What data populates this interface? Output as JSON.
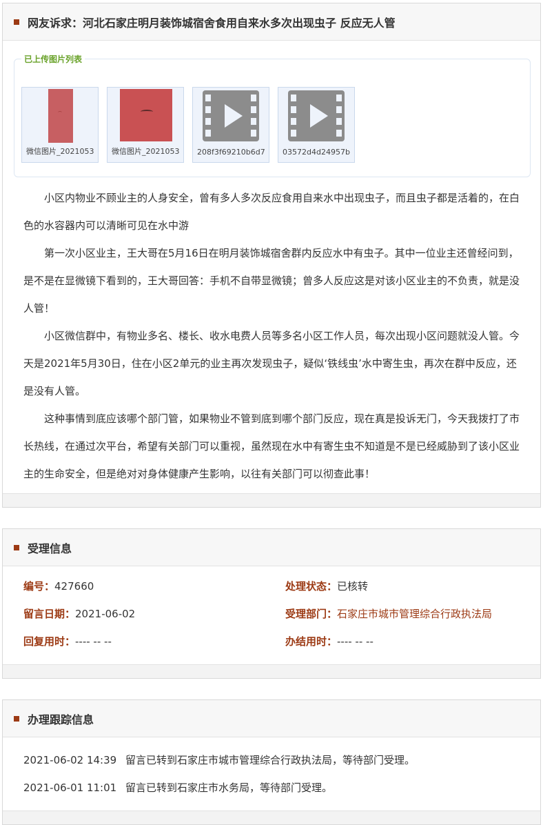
{
  "petition": {
    "title": "网友诉求：河北石家庄明月装饰城宿舍食用自来水多次出现虫子 反应无人管",
    "uploads_legend": "已上传图片列表",
    "uploads": [
      {
        "caption": "微信图片_2021053",
        "type": "image"
      },
      {
        "caption": "微信图片_2021053",
        "type": "image"
      },
      {
        "caption": "208f3f69210b6d7",
        "type": "video",
        "icon": "film-play-icon"
      },
      {
        "caption": "03572d4d24957b",
        "type": "video",
        "icon": "film-play-icon"
      }
    ],
    "paragraphs": [
      "小区内物业不顾业主的人身安全，曾有多人多次反应食用自来水中出现虫子，而且虫子都是活着的，在白色的水容器内可以清晰可见在水中游",
      "第一次小区业主，王大哥在5月16日在明月装饰城宿舍群内反应水中有虫子。其中一位业主还曾经问到，是不是在显微镜下看到的，王大哥回答：手机不自带显微镜；曾多人反应这是对该小区业主的不负责，就是没人管！",
      "小区微信群中，有物业多名、楼长、收水电费人员等多名小区工作人员，每次出现小区问题就没人管。今天是2021年5月30日，住在小区2单元的业主再次发现虫子，疑似‘铁线虫’水中寄生虫，再次在群中反应，还是没有人管。",
      "这种事情到底应该哪个部门管，如果物业不管到底到哪个部门反应，现在真是投诉无门，今天我拨打了市长热线，在通过次平台，希望有关部门可以重视，虽然现在水中有寄生虫不知道是不是已经威胁到了该小区业主的生命安全，但是绝对对身体健康产生影响，以往有关部门可以彻查此事！"
    ]
  },
  "acceptance": {
    "title": "受理信息",
    "id_label": "编号：",
    "id_value": "427660",
    "status_label": "处理状态：",
    "status_value": "已核转",
    "date_label": "留言日期：",
    "date_value": "2021-06-02",
    "dept_label": "受理部门：",
    "dept_value": "石家庄市城市管理综合行政执法局",
    "reply_label": "回复用时：",
    "reply_value": "---- -- --",
    "finish_label": "办结用时：",
    "finish_value": "---- -- --"
  },
  "tracking": {
    "title": "办理跟踪信息",
    "entries": [
      {
        "time": "2021-06-02 14:39",
        "text": "留言已转到石家庄市城市管理综合行政执法局，等待部门受理。"
      },
      {
        "time": "2021-06-01 11:01",
        "text": "留言已转到石家庄市水务局，等待部门受理。"
      }
    ]
  },
  "colors": {
    "accent": "#9c3a14",
    "legend": "#6aa32b"
  }
}
